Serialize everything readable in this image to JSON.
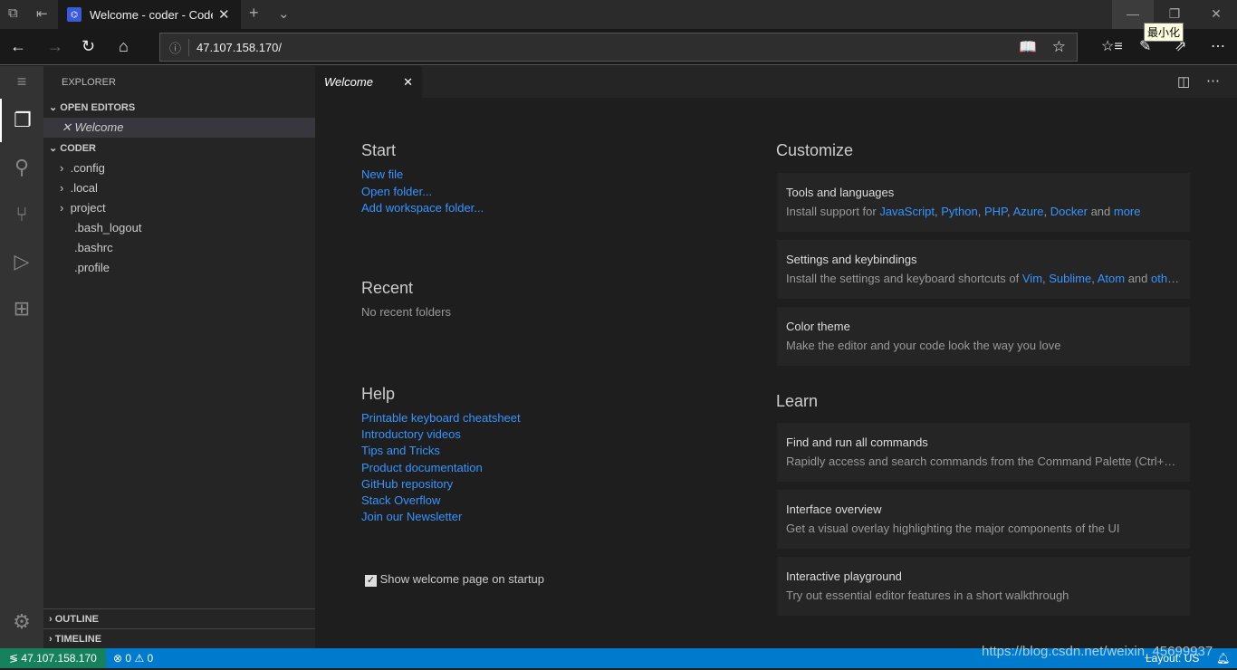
{
  "browser": {
    "tab_title": "Welcome - coder - Code",
    "url": "47.107.158.170/",
    "tooltip": "最小化"
  },
  "sidebar": {
    "title": "EXPLORER",
    "open_editors": "OPEN EDITORS",
    "open_item": "Welcome",
    "folder": "CODER",
    "items": [
      {
        "label": ".config",
        "dir": true
      },
      {
        "label": ".local",
        "dir": true
      },
      {
        "label": "project",
        "dir": true
      },
      {
        "label": ".bash_logout",
        "dir": false
      },
      {
        "label": ".bashrc",
        "dir": false
      },
      {
        "label": ".profile",
        "dir": false
      }
    ],
    "outline": "OUTLINE",
    "timeline": "TIMELINE"
  },
  "editor": {
    "tab": "Welcome"
  },
  "welcome": {
    "start": {
      "title": "Start",
      "links": [
        "New file",
        "Open folder...",
        "Add workspace folder..."
      ]
    },
    "recent": {
      "title": "Recent",
      "empty": "No recent folders"
    },
    "help": {
      "title": "Help",
      "links": [
        "Printable keyboard cheatsheet",
        "Introductory videos",
        "Tips and Tricks",
        "Product documentation",
        "GitHub repository",
        "Stack Overflow",
        "Join our Newsletter"
      ]
    },
    "startup_checkbox": {
      "label": "Show welcome page on startup",
      "checked": true
    },
    "customize": {
      "title": "Customize",
      "cards": [
        {
          "title": "Tools and languages",
          "desc_prefix": "Install support for ",
          "links": [
            "JavaScript",
            "Python",
            "PHP",
            "Azure",
            "Docker"
          ],
          "desc_suffix": " and ",
          "last": "more"
        },
        {
          "title": "Settings and keybindings",
          "desc_prefix": "Install the settings and keyboard shortcuts of ",
          "links": [
            "Vim",
            "Sublime",
            "Atom"
          ],
          "desc_suffix": " and ",
          "last": "others"
        },
        {
          "title": "Color theme",
          "desc": "Make the editor and your code look the way you love"
        }
      ]
    },
    "learn": {
      "title": "Learn",
      "cards": [
        {
          "title": "Find and run all commands",
          "desc": "Rapidly access and search commands from the Command Palette (Ctrl+Shift+P)"
        },
        {
          "title": "Interface overview",
          "desc": "Get a visual overlay highlighting the major components of the UI"
        },
        {
          "title": "Interactive playground",
          "desc": "Try out essential editor features in a short walkthrough"
        }
      ]
    }
  },
  "status": {
    "remote": "47.107.158.170",
    "errors": "0",
    "warnings": "0",
    "layout": "Layout: US"
  },
  "watermark": "https://blog.csdn.net/weixin_45699937",
  "colors": {
    "accent": "#007acc",
    "link": "#3794ff",
    "remote": "#16825d"
  }
}
